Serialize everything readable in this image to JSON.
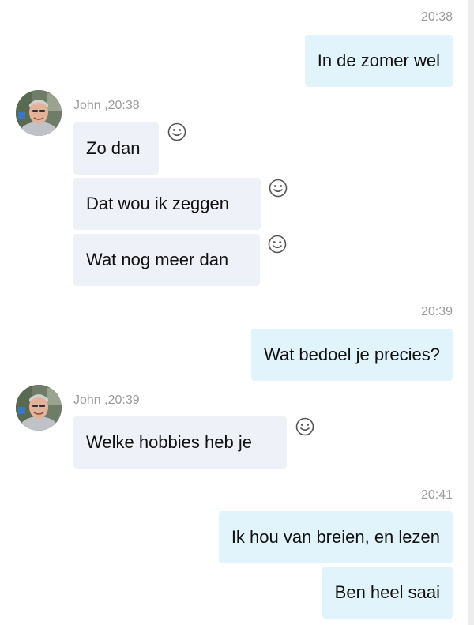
{
  "messages": [
    {
      "type": "timestamp",
      "time": "20:38"
    },
    {
      "type": "outgoing",
      "text": "In de zomer wel"
    },
    {
      "type": "incoming_group",
      "sender": "John",
      "time": "20:38",
      "sender_time_label": "John ,20:38",
      "bubbles": [
        "Zo dan",
        "Dat wou ik zeggen",
        "Wat nog meer dan"
      ]
    },
    {
      "type": "timestamp",
      "time": "20:39"
    },
    {
      "type": "outgoing",
      "text": "Wat bedoel je precies?"
    },
    {
      "type": "incoming_group",
      "sender": "John",
      "time": "20:39",
      "sender_time_label": "John ,20:39",
      "bubbles": [
        "Welke hobbies heb je"
      ]
    },
    {
      "type": "timestamp",
      "time": "20:41"
    },
    {
      "type": "outgoing",
      "text": "Ik hou van breien, en lezen"
    },
    {
      "type": "outgoing",
      "text": "Ben heel saai"
    }
  ],
  "icons": {
    "reaction": "smiley-face-icon",
    "avatar": "user-avatar-photo"
  },
  "colors": {
    "outgoing_bubble": "#e2f4fb",
    "incoming_bubble": "#eff1f9",
    "meta_text": "#9a9a9a",
    "message_text": "#111111"
  }
}
